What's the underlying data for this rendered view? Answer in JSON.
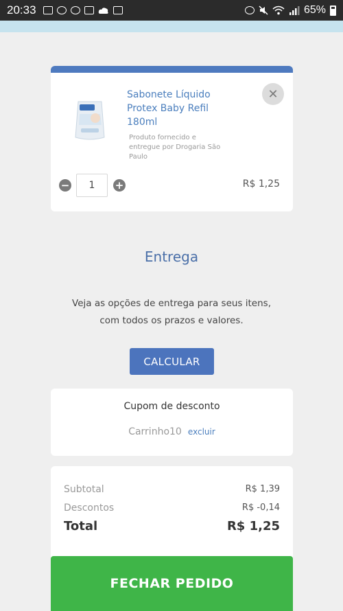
{
  "status_bar": {
    "time": "20:33",
    "battery_percent": "65%",
    "left_icons": [
      "image-icon",
      "leaf-icon",
      "tool-icon",
      "gallery-icon",
      "cloud-icon",
      "download-icon"
    ],
    "right_icons": [
      "alarm-icon",
      "mute-icon",
      "wifi-icon",
      "signal-icon",
      "battery-icon"
    ]
  },
  "cart_item": {
    "name": "Sabonete Líquido Protex Baby Refil 180ml",
    "seller_note": "Produto fornecido e entregue por Drogaria São Paulo",
    "quantity": "1",
    "price": "R$ 1,25",
    "remove_symbol": "✕",
    "minus_symbol": "−",
    "plus_symbol": "+"
  },
  "delivery": {
    "title": "Entrega",
    "line1": "Veja as opções de entrega para seus itens,",
    "line2": "com todos os prazos e valores.",
    "calculate_label": "CALCULAR"
  },
  "coupon": {
    "title": "Cupom de desconto",
    "code": "Carrinho10",
    "remove_label": "excluir"
  },
  "totals": {
    "subtotal_label": "Subtotal",
    "subtotal_value": "R$ 1,39",
    "discounts_label": "Descontos",
    "discounts_value": "R$ -0,14",
    "total_label": "Total",
    "total_value": "R$ 1,25"
  },
  "checkout_label": "FECHAR PEDIDO",
  "colors": {
    "accent_blue": "#4e7abf",
    "link_blue": "#4a7ebd",
    "checkout_green": "#3fb548",
    "status_bar": "#2b2b2b"
  }
}
